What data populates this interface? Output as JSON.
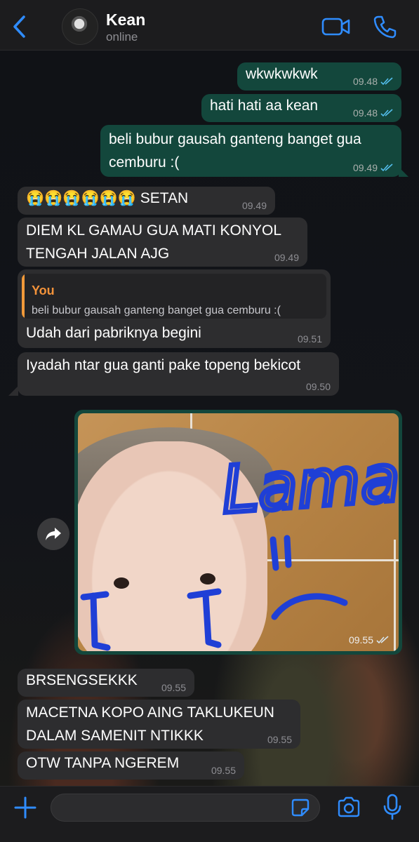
{
  "header": {
    "contact_name": "Kean",
    "status": "online",
    "icons": [
      "back-chevron-icon",
      "video-call-icon",
      "voice-call-icon"
    ]
  },
  "messages": [
    {
      "direction": "out",
      "text": "wkwkwkwk",
      "time": "09.48",
      "read": true
    },
    {
      "direction": "out",
      "text": "hati hati aa kean",
      "time": "09.48",
      "read": true
    },
    {
      "direction": "out",
      "lines": [
        "beli bubur gausah ganteng banget gua",
        "cemburu :("
      ],
      "time": "09.49",
      "read": true
    },
    {
      "direction": "in",
      "text": "😭😭😭😭😭😭 SETAN",
      "time": "09.49"
    },
    {
      "direction": "in",
      "lines": [
        "DIEM KL GAMAU GUA MATI KONYOL",
        "TENGAH JALAN AJG"
      ],
      "time": "09.49"
    },
    {
      "direction": "in",
      "reply_to": {
        "author": "You",
        "text": "beli bubur gausah ganteng banget gua cemburu :("
      },
      "text": "Udah dari pabriknya begini",
      "time": "09.51"
    },
    {
      "direction": "in",
      "text": "Iyadah ntar gua ganti pake topeng bekicot",
      "time": "09.50"
    },
    {
      "direction": "out",
      "type": "image",
      "time": "09.55",
      "read": true,
      "drawn_text": "Lama"
    },
    {
      "direction": "in",
      "text": "BRSENGSEKKK",
      "time": "09.55"
    },
    {
      "direction": "in",
      "lines": [
        "MACETNA KOPO AING TAKLUKEUN",
        "DALAM SAMENIT NTIKKK"
      ],
      "time": "09.55"
    },
    {
      "direction": "in",
      "text": "OTW TANPA NGEREM",
      "time": "09.55"
    }
  ],
  "composer": {
    "placeholder": "",
    "icons": [
      "plus-icon",
      "sticker-icon",
      "camera-icon",
      "microphone-icon"
    ]
  },
  "colors": {
    "outgoing_bubble": "#13473c",
    "incoming_bubble": "#2d2d2f",
    "accent_blue": "#2f8cff",
    "read_ticks": "#53bdeb",
    "quote_accent": "#f29a3a"
  }
}
